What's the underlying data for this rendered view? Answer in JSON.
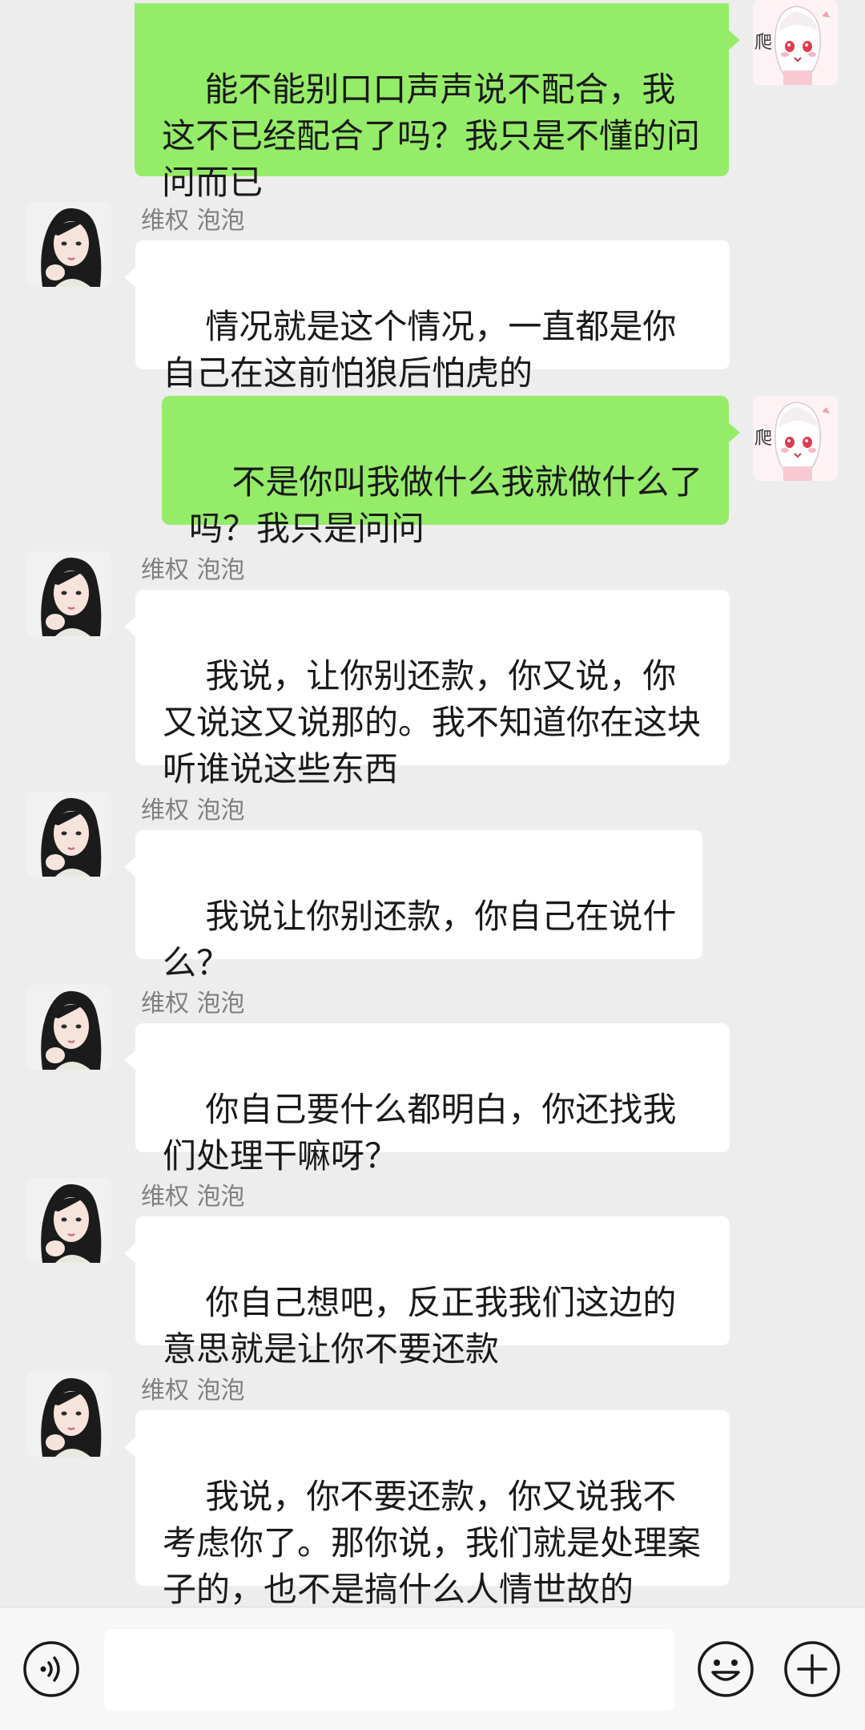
{
  "messages": [
    {
      "side": "out",
      "text": "能不能别口口声声说不配合，我这不已经配合了吗？我只是不懂的问问而已"
    },
    {
      "side": "in",
      "name": "维权 泡泡",
      "text": "情况就是这个情况，一直都是你自己在这前怕狼后怕虎的"
    },
    {
      "side": "out",
      "text": "不是你叫我做什么我就做什么了吗？我只是问问"
    },
    {
      "side": "in",
      "name": "维权 泡泡",
      "text": "我说，让你别还款，你又说，你又说这又说那的。我不知道你在这块听谁说这些东西"
    },
    {
      "side": "in",
      "name": "维权 泡泡",
      "text": "我说让你别还款，你自己在说什么？"
    },
    {
      "side": "in",
      "name": "维权 泡泡",
      "text": "你自己要什么都明白，你还找我们处理干嘛呀？"
    },
    {
      "side": "in",
      "name": "维权 泡泡",
      "text": "你自己想吧，反正我我们这边的意思就是让你不要还款"
    },
    {
      "side": "in",
      "name": "维权 泡泡",
      "text": "我说，你不要还款，你又说我不考虑你了。那你说，我们就是处理案子的，也不是搞什么人情世故的"
    }
  ],
  "self_avatar": {
    "icon": "anime-girl-avatar",
    "caption": "爬"
  },
  "other_avatar": {
    "icon": "woman-avatar"
  },
  "input_bar": {
    "voice_icon": "voice-icon",
    "emoji_icon": "emoji-icon",
    "plus_icon": "plus-icon",
    "input_value": ""
  },
  "colors": {
    "background": "#ededed",
    "outgoing_bubble": "#95ec69",
    "incoming_bubble": "#ffffff",
    "name_text": "#808080"
  }
}
